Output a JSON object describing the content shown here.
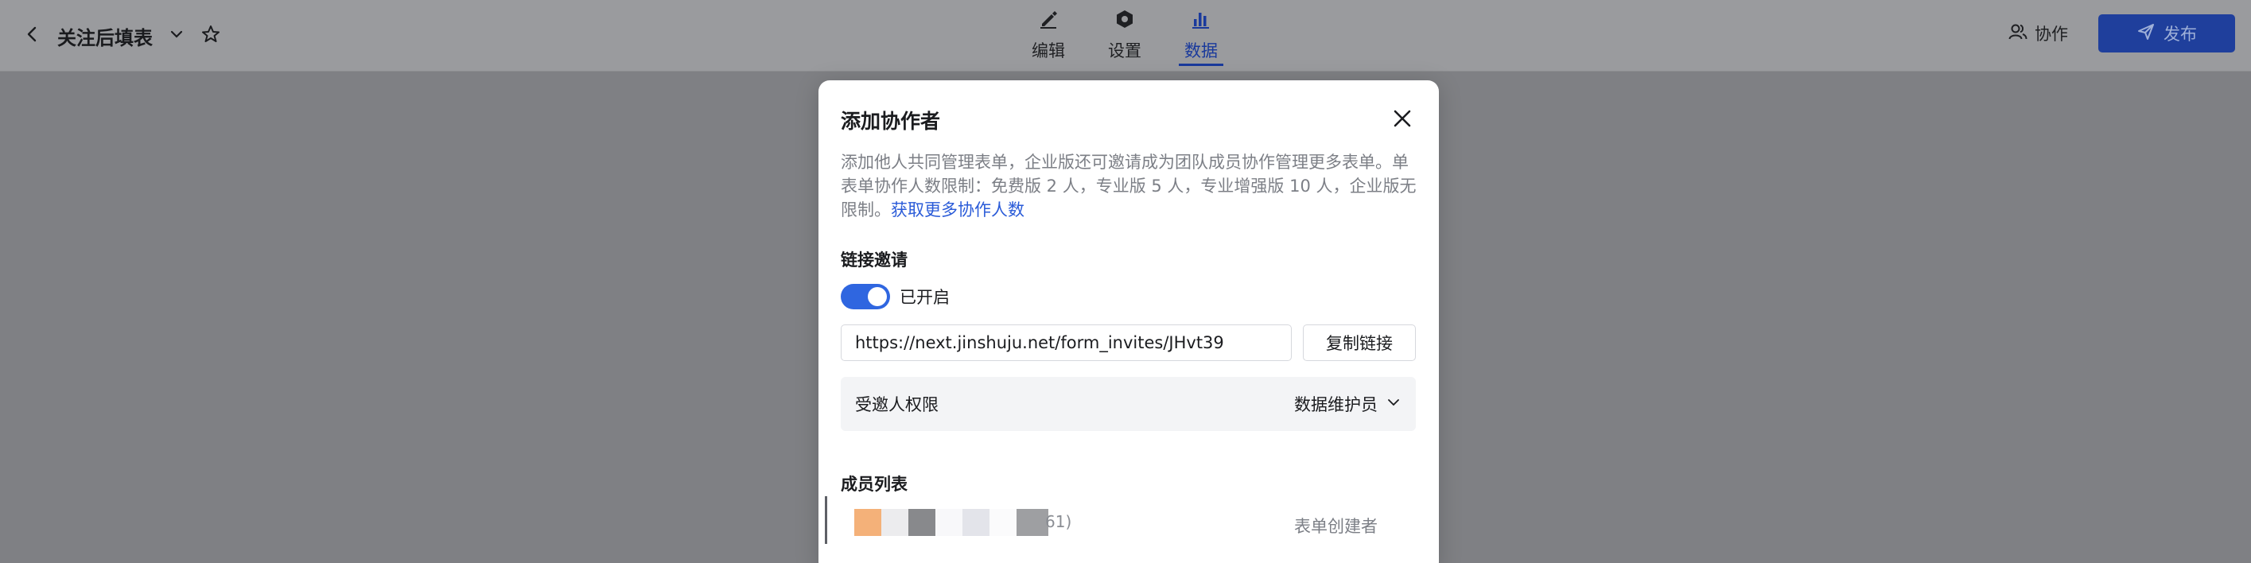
{
  "header": {
    "title": "关注后填表",
    "tabs": [
      {
        "label": "编辑",
        "icon": "pen-icon"
      },
      {
        "label": "设置",
        "icon": "settings-hex-icon"
      },
      {
        "label": "数据",
        "icon": "bar-chart-icon",
        "active": true
      }
    ],
    "collab_label": "协作",
    "publish_label": "发布"
  },
  "modal": {
    "title": "添加协作者",
    "desc_line": "添加他人共同管理表单，企业版还可邀请成为团队成员协作管理更多表单。单表单协作人数限制：免费版 2 人，专业版 5 人，专业增强版 10 人，企业版无限制。",
    "desc_link": "获取更多协作人数",
    "link_invite_title": "链接邀请",
    "toggle_label": "已开启",
    "invite_url": "https://next.jinshuju.net/form_invites/JHvt39",
    "copy_label": "复制链接",
    "permission_label": "受邀人权限",
    "permission_value": "数据维护员",
    "member_list_title": "成员列表",
    "member": {
      "id_fragment": "61)",
      "role": "表单创建者"
    }
  },
  "colors": {
    "accent": "#2f66e0",
    "publish_bg": "#1f3f9c",
    "link": "#2a5bd8"
  }
}
